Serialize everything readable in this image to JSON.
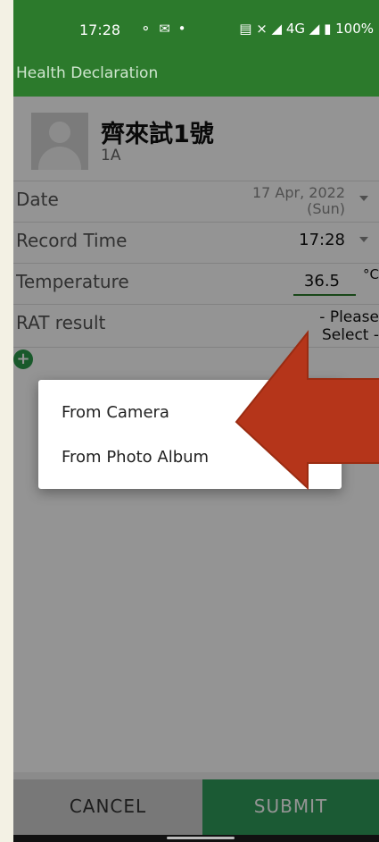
{
  "status_bar": {
    "time": "17:28",
    "notification_icons": "⚬ ✉ •",
    "right_icons": "▤ ⨯ ◢ 4G ◢ ▮ 100%"
  },
  "app_bar": {
    "title": "Health Declaration"
  },
  "profile": {
    "name": "齊來試1號",
    "class": "1A"
  },
  "form": {
    "date": {
      "label": "Date",
      "value": "17 Apr, 2022 (Sun)"
    },
    "record_time": {
      "label": "Record Time",
      "value": "17:28"
    },
    "temperature": {
      "label": "Temperature",
      "value": "36.5",
      "unit": "°C"
    },
    "rat_result": {
      "label": "RAT result",
      "value": "- Please Select -"
    }
  },
  "dialog": {
    "items": [
      {
        "label": "From Camera"
      },
      {
        "label": "From Photo Album"
      }
    ]
  },
  "buttons": {
    "cancel": "CANCEL",
    "submit": "SUBMIT"
  },
  "colors": {
    "brand_green": "#2c7a2c",
    "submit_green": "#2f9b5a",
    "arrow_fill": "#b5351a",
    "arrow_stroke": "#9a2c12"
  }
}
